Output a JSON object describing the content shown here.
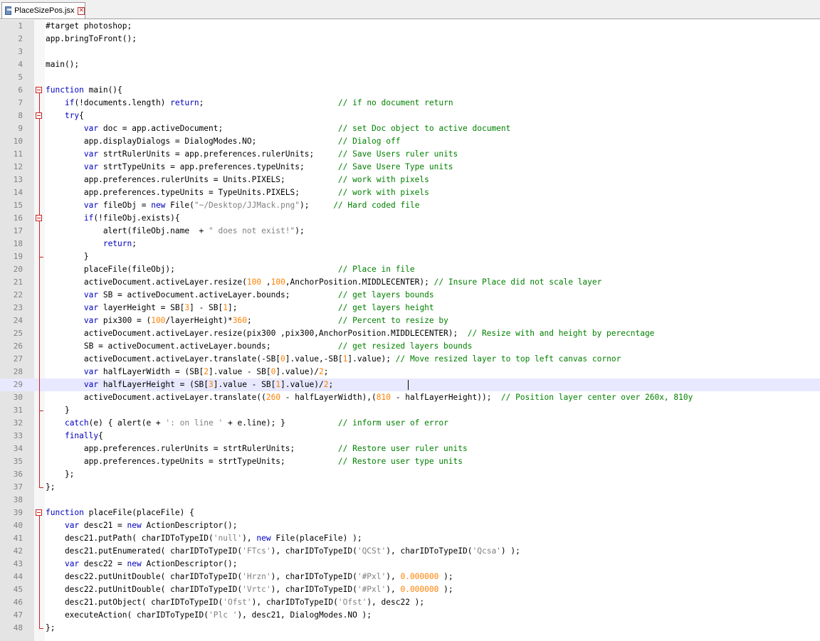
{
  "tab": {
    "label": "PlaceSizePos.jsx",
    "close_symbol": "✕"
  },
  "colors": {
    "keyword": "#0000c0",
    "string": "#808080",
    "number": "#ff8000",
    "comment": "#008000",
    "fold_marker": "#c22222",
    "current_line": "#e8e8ff"
  },
  "editor": {
    "current_line": 29,
    "lines": [
      "#target photoshop;",
      "app.bringToFront();",
      "",
      "main();",
      "",
      "function main(){",
      "    if(!documents.length) return;                            // if no document return",
      "    try{",
      "        var doc = app.activeDocument;                        // set Doc object to active document",
      "        app.displayDialogs = DialogModes.NO;                 // Dialog off",
      "        var strtRulerUnits = app.preferences.rulerUnits;     // Save Users ruler units",
      "        var strtTypeUnits = app.preferences.typeUnits;       // Save Usere Type units",
      "        app.preferences.rulerUnits = Units.PIXELS;           // work with pixels",
      "        app.preferences.typeUnits = TypeUnits.PIXELS;        // work with pixels",
      "        var fileObj = new File(\"~/Desktop/JJMack.png\");     // Hard coded file",
      "        if(!fileObj.exists){",
      "            alert(fileObj.name  + \" does not exist!\");",
      "            return;",
      "        }",
      "        placeFile(fileObj);                                  // Place in file",
      "        activeDocument.activeLayer.resize(100 ,100,AnchorPosition.MIDDLECENTER); // Insure Place did not scale layer",
      "        var SB = activeDocument.activeLayer.bounds;          // get layers bounds",
      "        var layerHeight = SB[3] - SB[1];                     // get layers height",
      "        var pix300 = (100/layerHeight)*360;                  // Percent to resize by",
      "        activeDocument.activeLayer.resize(pix300 ,pix300,AnchorPosition.MIDDLECENTER);  // Resize with and height by perecntage",
      "        SB = activeDocument.activeLayer.bounds;              // get resized layers bounds",
      "        activeDocument.activeLayer.translate(-SB[0].value,-SB[1].value); // Move resized layer to top left canvas cornor",
      "        var halfLayerWidth = (SB[2].value - SB[0].value)/2;",
      "        var halfLayerHeight = (SB[3].value - SB[1].value)/2;",
      "        activeDocument.activeLayer.translate((260 - halfLayerWidth),(810 - halfLayerHeight));  // Position layer center over 260x, 810y",
      "    }",
      "    catch(e) { alert(e + ': on line ' + e.line); }           // inform user of error",
      "    finally{",
      "        app.preferences.rulerUnits = strtRulerUnits;         // Restore user ruler units",
      "        app.preferences.typeUnits = strtTypeUnits;           // Restore user type units",
      "    };",
      "};",
      "",
      "function placeFile(placeFile) {",
      "    var desc21 = new ActionDescriptor();",
      "    desc21.putPath( charIDToTypeID('null'), new File(placeFile) );",
      "    desc21.putEnumerated( charIDToTypeID('FTcs'), charIDToTypeID('QCSt'), charIDToTypeID('Qcsa') );",
      "    var desc22 = new ActionDescriptor();",
      "    desc22.putUnitDouble( charIDToTypeID('Hrzn'), charIDToTypeID('#Pxl'), 0.000000 );",
      "    desc22.putUnitDouble( charIDToTypeID('Vrtc'), charIDToTypeID('#Pxl'), 0.000000 );",
      "    desc21.putObject( charIDToTypeID('Ofst'), charIDToTypeID('Ofst'), desc22 );",
      "    executeAction( charIDToTypeID('Plc '), desc21, DialogModes.NO );",
      "};"
    ]
  }
}
